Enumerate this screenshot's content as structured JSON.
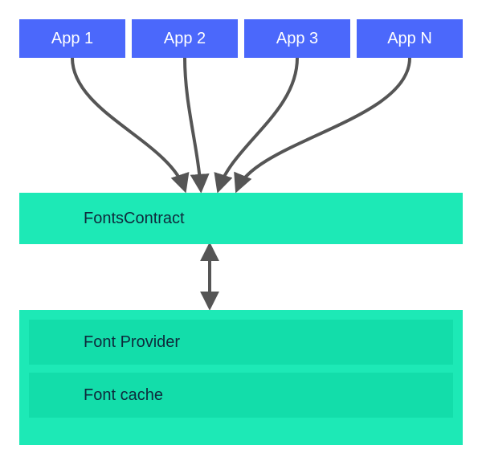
{
  "apps": [
    {
      "label": "App 1"
    },
    {
      "label": "App 2"
    },
    {
      "label": "App 3"
    },
    {
      "label": "App N"
    }
  ],
  "layers": {
    "contracts": "FontsContract",
    "provider": "Font Provider",
    "cache": "Font cache"
  },
  "colors": {
    "app_bg": "#4b68fb",
    "app_text": "#ffffff",
    "slab_bg": "#1de9b6",
    "slab_inner_bg": "#13ddaa",
    "slab_text": "#0e2a3c",
    "arrow": "#555555"
  },
  "chart_data": {
    "type": "diagram",
    "nodes": [
      {
        "id": "app1",
        "label": "App 1",
        "tier": "apps"
      },
      {
        "id": "app2",
        "label": "App 2",
        "tier": "apps"
      },
      {
        "id": "app3",
        "label": "App 3",
        "tier": "apps"
      },
      {
        "id": "appN",
        "label": "App N",
        "tier": "apps"
      },
      {
        "id": "contracts",
        "label": "FontsContract",
        "tier": "middleware"
      },
      {
        "id": "provider",
        "label": "Font Provider",
        "tier": "backend"
      },
      {
        "id": "cache",
        "label": "Font cache",
        "tier": "backend",
        "parent": "provider"
      }
    ],
    "edges": [
      {
        "from": "app1",
        "to": "contracts",
        "bidirectional": false
      },
      {
        "from": "app2",
        "to": "contracts",
        "bidirectional": false
      },
      {
        "from": "app3",
        "to": "contracts",
        "bidirectional": false
      },
      {
        "from": "appN",
        "to": "contracts",
        "bidirectional": false
      },
      {
        "from": "contracts",
        "to": "provider",
        "bidirectional": true
      }
    ]
  }
}
